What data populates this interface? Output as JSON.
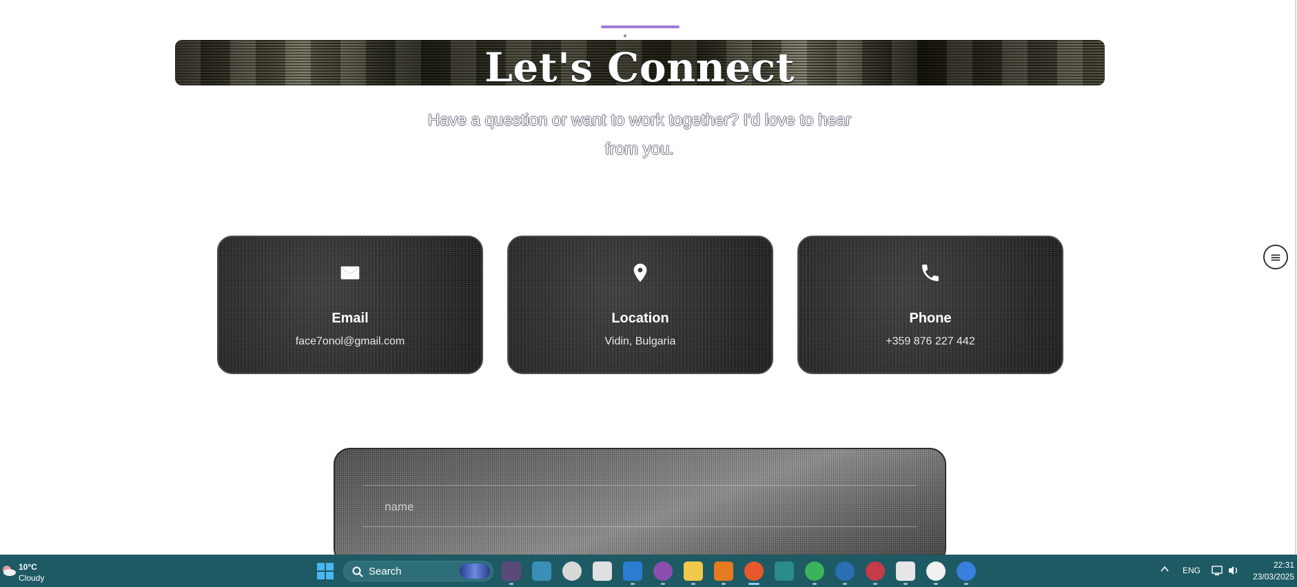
{
  "page": {
    "title": "Let's Connect",
    "subtitle": "Have a question or want to work together? I'd love to hear from you."
  },
  "cards": [
    {
      "title": "Email",
      "value": "face7onol@gmail.com",
      "icon": "mail-icon"
    },
    {
      "title": "Location",
      "value": "Vidin, Bulgaria",
      "icon": "location-pin-icon"
    },
    {
      "title": "Phone",
      "value": "+359 876 227 442",
      "icon": "phone-icon"
    }
  ],
  "form": {
    "name_label": "name"
  },
  "taskbar": {
    "weather": {
      "temp": "10°C",
      "desc": "Cloudy",
      "icon": "cloudy-weather-icon"
    },
    "search_label": "Search",
    "apps": [
      "app-game",
      "app-window",
      "app-settings",
      "app-photos",
      "app-vscode",
      "app-github",
      "app-file-explorer",
      "app-sublime",
      "app-firefox",
      "app-vs",
      "app-chrome",
      "app-network",
      "app-davinci",
      "app-terminal",
      "app-ai",
      "app-copilot"
    ],
    "language": "ENG",
    "time": "22:31",
    "date": "23/03/2025"
  },
  "colors": {
    "accent": "#a07ad8",
    "taskbar": "#1d5a64"
  }
}
